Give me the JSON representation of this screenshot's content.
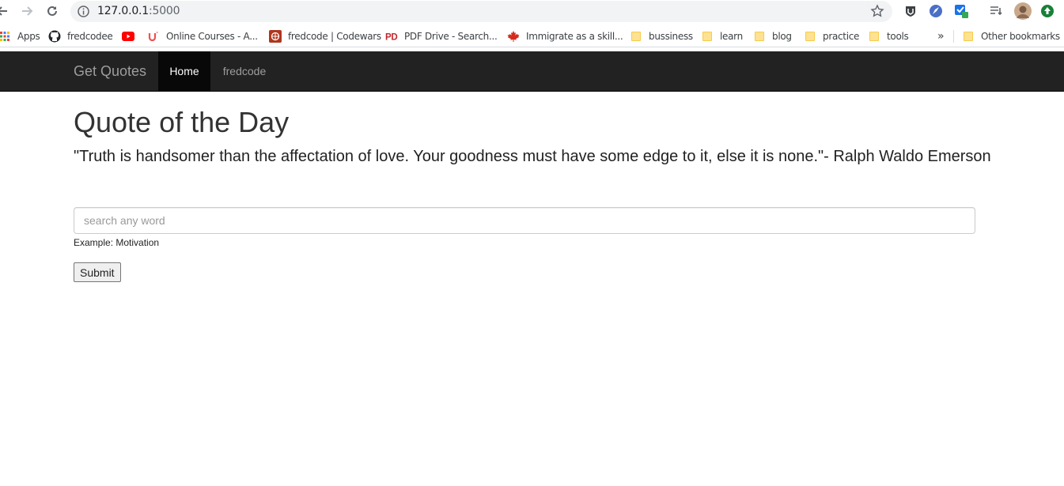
{
  "browser": {
    "url_host": "127.0.0.1",
    "url_port": ":5000",
    "bookmarks": [
      {
        "label": "Apps",
        "icon": "apps-grid-icon"
      },
      {
        "label": "fredcodee",
        "icon": "github-icon"
      },
      {
        "label": "",
        "icon": "youtube-icon"
      },
      {
        "label": "Online Courses - A...",
        "icon": "udemy-icon"
      },
      {
        "label": "fredcode | Codewars",
        "icon": "codewars-icon"
      },
      {
        "label": "PDF Drive - Search...",
        "icon": "pdfdrive-icon"
      },
      {
        "label": "Immigrate as a skill...",
        "icon": "maple-leaf-icon"
      },
      {
        "label": "bussiness",
        "icon": "folder-icon"
      },
      {
        "label": "learn",
        "icon": "folder-icon"
      },
      {
        "label": "blog",
        "icon": "folder-icon"
      },
      {
        "label": "practice",
        "icon": "folder-icon"
      },
      {
        "label": "tools",
        "icon": "folder-icon"
      }
    ],
    "overflow_label": "»",
    "other_bookmarks": "Other bookmarks"
  },
  "navbar": {
    "brand": "Get Quotes",
    "items": [
      "Home",
      "fredcode"
    ],
    "active": "Home"
  },
  "main": {
    "title": "Quote of the Day",
    "quote": "\"Truth is handsomer than the affectation of love. Your goodness must have some edge to it, else it is none.\"- Ralph Waldo Emerson",
    "search_placeholder": "search any word",
    "search_value": "",
    "example_text": "Example: Motivation",
    "submit_label": "Submit"
  },
  "colors": {
    "navbar_bg": "#222222",
    "navbar_active_bg": "#080808",
    "navbar_text": "#9d9d9d",
    "omnibox_bg": "#f1f3f4",
    "folder": "#fde293"
  }
}
